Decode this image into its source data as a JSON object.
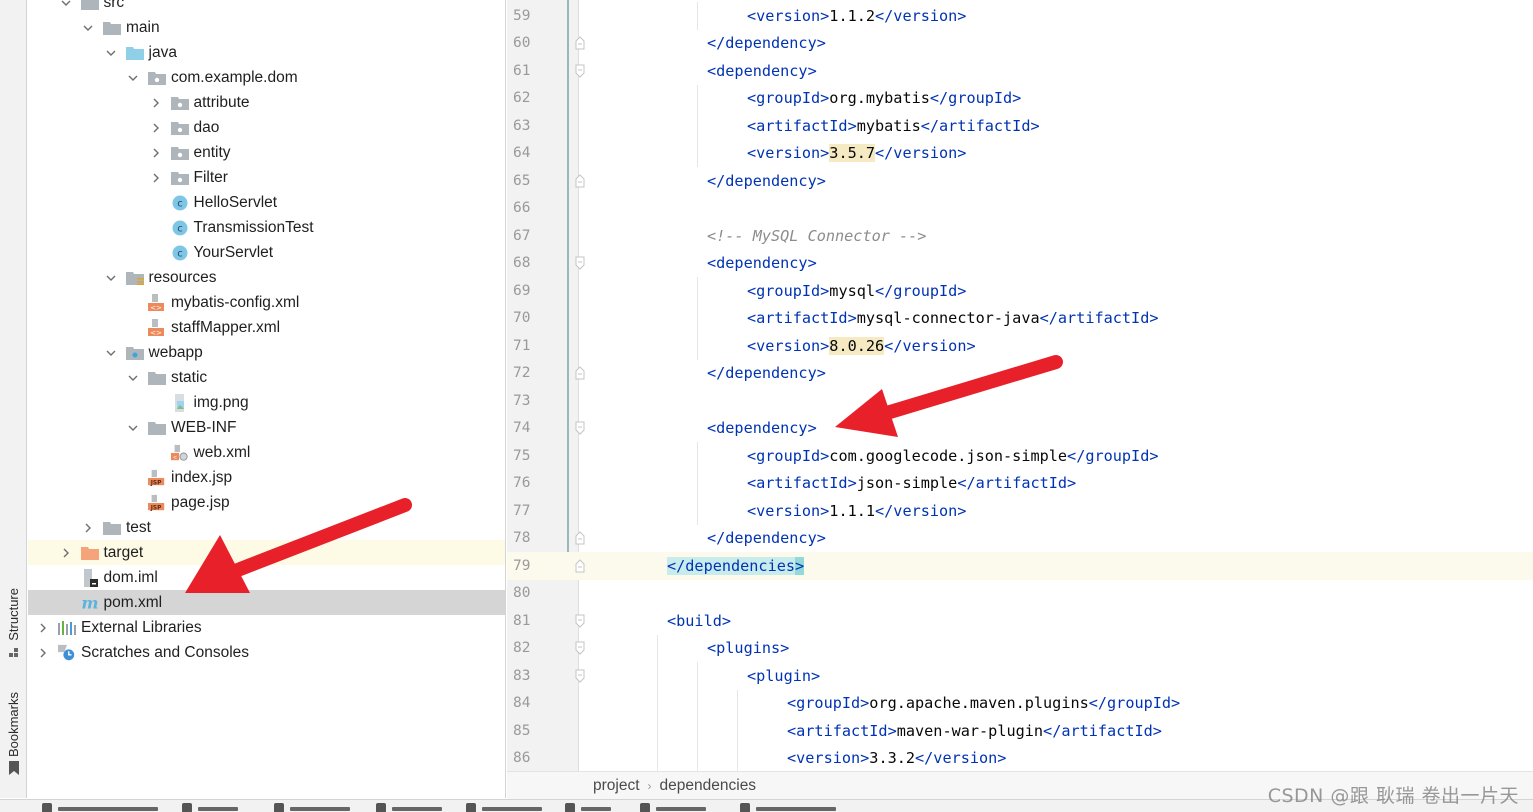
{
  "tool_strip": {
    "structure_label": "Structure",
    "bookmarks_label": "Bookmarks"
  },
  "project_tree": [
    {
      "label": "src",
      "depth": 2,
      "icon": "folder-icon",
      "expanded": true
    },
    {
      "label": "main",
      "depth": 3,
      "icon": "folder-icon",
      "expanded": true
    },
    {
      "label": "java",
      "depth": 4,
      "icon": "source-folder-icon",
      "expanded": true
    },
    {
      "label": "com.example.dom",
      "depth": 5,
      "icon": "package-icon",
      "expanded": true
    },
    {
      "label": "attribute",
      "depth": 6,
      "icon": "package-icon",
      "expanded": false
    },
    {
      "label": "dao",
      "depth": 6,
      "icon": "package-icon",
      "expanded": false
    },
    {
      "label": "entity",
      "depth": 6,
      "icon": "package-icon",
      "expanded": false
    },
    {
      "label": "Filter",
      "depth": 6,
      "icon": "package-icon",
      "expanded": false
    },
    {
      "label": "HelloServlet",
      "depth": 6,
      "icon": "class-icon",
      "leaf": true
    },
    {
      "label": "TransmissionTest",
      "depth": 6,
      "icon": "class-icon",
      "leaf": true
    },
    {
      "label": "YourServlet",
      "depth": 6,
      "icon": "class-icon",
      "leaf": true
    },
    {
      "label": "resources",
      "depth": 4,
      "icon": "resources-folder-icon",
      "expanded": true
    },
    {
      "label": "mybatis-config.xml",
      "depth": 5,
      "icon": "xml-file-icon",
      "leaf": true
    },
    {
      "label": "staffMapper.xml",
      "depth": 5,
      "icon": "xml-file-icon",
      "leaf": true
    },
    {
      "label": "webapp",
      "depth": 4,
      "icon": "web-folder-icon",
      "expanded": true
    },
    {
      "label": "static",
      "depth": 5,
      "icon": "folder-icon",
      "expanded": true
    },
    {
      "label": "img.png",
      "depth": 6,
      "icon": "image-file-icon",
      "leaf": true
    },
    {
      "label": "WEB-INF",
      "depth": 5,
      "icon": "folder-icon",
      "expanded": true
    },
    {
      "label": "web.xml",
      "depth": 6,
      "icon": "web-xml-file-icon",
      "leaf": true
    },
    {
      "label": "index.jsp",
      "depth": 5,
      "icon": "jsp-file-icon",
      "leaf": true
    },
    {
      "label": "page.jsp",
      "depth": 5,
      "icon": "jsp-file-icon",
      "leaf": true
    },
    {
      "label": "test",
      "depth": 3,
      "icon": "folder-icon",
      "expanded": false
    },
    {
      "label": "target",
      "depth": 2,
      "icon": "excluded-folder-icon",
      "expanded": false,
      "highlight": "yellow"
    },
    {
      "label": "dom.iml",
      "depth": 2,
      "icon": "iml-file-icon",
      "leaf": true
    },
    {
      "label": "pom.xml",
      "depth": 2,
      "icon": "maven-icon",
      "leaf": true,
      "selected": true
    },
    {
      "label": "External Libraries",
      "depth": 1,
      "icon": "libraries-icon",
      "expanded": false
    },
    {
      "label": "Scratches and Consoles",
      "depth": 1,
      "icon": "scratches-icon",
      "expanded": false
    }
  ],
  "editor": {
    "caret_line": 79,
    "lines": [
      {
        "n": "59",
        "indent": 3,
        "parts": [
          [
            "tag",
            "<version>"
          ],
          [
            "txt",
            "1.1.2"
          ],
          [
            "tag",
            "</version>"
          ]
        ]
      },
      {
        "n": "60",
        "indent": 2,
        "fold": "end",
        "parts": [
          [
            "tag",
            "</dependency>"
          ]
        ]
      },
      {
        "n": "61",
        "indent": 2,
        "fold": "start",
        "parts": [
          [
            "tag",
            "<dependency>"
          ]
        ]
      },
      {
        "n": "62",
        "indent": 3,
        "parts": [
          [
            "tag",
            "<groupId>"
          ],
          [
            "txt",
            "org.mybatis"
          ],
          [
            "tag",
            "</groupId>"
          ]
        ]
      },
      {
        "n": "63",
        "indent": 3,
        "parts": [
          [
            "tag",
            "<artifactId>"
          ],
          [
            "txt",
            "mybatis"
          ],
          [
            "tag",
            "</artifactId>"
          ]
        ]
      },
      {
        "n": "64",
        "indent": 3,
        "parts": [
          [
            "tag",
            "<version>"
          ],
          [
            "hl",
            "3.5.7"
          ],
          [
            "tag",
            "</version>"
          ]
        ]
      },
      {
        "n": "65",
        "indent": 2,
        "fold": "end",
        "parts": [
          [
            "tag",
            "</dependency>"
          ]
        ]
      },
      {
        "n": "66",
        "indent": 0,
        "parts": []
      },
      {
        "n": "67",
        "indent": 2,
        "parts": [
          [
            "cmt",
            "<!-- MySQL Connector -->"
          ]
        ]
      },
      {
        "n": "68",
        "indent": 2,
        "fold": "start",
        "parts": [
          [
            "tag",
            "<dependency>"
          ]
        ]
      },
      {
        "n": "69",
        "indent": 3,
        "parts": [
          [
            "tag",
            "<groupId>"
          ],
          [
            "txt",
            "mysql"
          ],
          [
            "tag",
            "</groupId>"
          ]
        ]
      },
      {
        "n": "70",
        "indent": 3,
        "parts": [
          [
            "tag",
            "<artifactId>"
          ],
          [
            "txt",
            "mysql-connector-java"
          ],
          [
            "tag",
            "</artifactId>"
          ]
        ]
      },
      {
        "n": "71",
        "indent": 3,
        "parts": [
          [
            "tag",
            "<version>"
          ],
          [
            "hl",
            "8.0.26"
          ],
          [
            "tag",
            "</version>"
          ]
        ]
      },
      {
        "n": "72",
        "indent": 2,
        "fold": "end",
        "parts": [
          [
            "tag",
            "</dependency>"
          ]
        ]
      },
      {
        "n": "73",
        "indent": 0,
        "parts": []
      },
      {
        "n": "74",
        "indent": 2,
        "fold": "start",
        "parts": [
          [
            "tag",
            "<dependency>"
          ]
        ]
      },
      {
        "n": "75",
        "indent": 3,
        "parts": [
          [
            "tag",
            "<groupId>"
          ],
          [
            "txt",
            "com.googlecode.json-simple"
          ],
          [
            "tag",
            "</groupId>"
          ]
        ]
      },
      {
        "n": "76",
        "indent": 3,
        "parts": [
          [
            "tag",
            "<artifactId>"
          ],
          [
            "txt",
            "json-simple"
          ],
          [
            "tag",
            "</artifactId>"
          ]
        ]
      },
      {
        "n": "77",
        "indent": 3,
        "parts": [
          [
            "tag",
            "<version>"
          ],
          [
            "txt",
            "1.1.1"
          ],
          [
            "tag",
            "</version>"
          ]
        ]
      },
      {
        "n": "78",
        "indent": 2,
        "fold": "end",
        "parts": [
          [
            "tag",
            "</dependency>"
          ]
        ]
      },
      {
        "n": "79",
        "indent": 1,
        "fold": "end",
        "parts": [
          [
            "brace",
            "</dependencies"
          ],
          [
            "brace-end",
            ">"
          ]
        ]
      },
      {
        "n": "80",
        "indent": 0,
        "parts": []
      },
      {
        "n": "81",
        "indent": 1,
        "fold": "start",
        "parts": [
          [
            "tag",
            "<build>"
          ]
        ]
      },
      {
        "n": "82",
        "indent": 2,
        "fold": "start",
        "parts": [
          [
            "tag",
            "<plugins>"
          ]
        ]
      },
      {
        "n": "83",
        "indent": 3,
        "fold": "start",
        "parts": [
          [
            "tag",
            "<plugin>"
          ]
        ]
      },
      {
        "n": "84",
        "indent": 4,
        "parts": [
          [
            "tag",
            "<groupId>"
          ],
          [
            "txt",
            "org.apache.maven.plugins"
          ],
          [
            "tag",
            "</groupId>"
          ]
        ]
      },
      {
        "n": "85",
        "indent": 4,
        "parts": [
          [
            "tag",
            "<artifactId>"
          ],
          [
            "txt",
            "maven-war-plugin"
          ],
          [
            "tag",
            "</artifactId>"
          ]
        ]
      },
      {
        "n": "86",
        "indent": 4,
        "parts": [
          [
            "tag",
            "<version>"
          ],
          [
            "txt",
            "3.3.2"
          ],
          [
            "tag",
            "</version>"
          ]
        ]
      }
    ]
  },
  "breadcrumb": {
    "items": [
      "project",
      "dependencies"
    ]
  },
  "watermark": "CSDN @跟 耿瑞 卷出一片天",
  "colors": {
    "tag": "#0033b3",
    "annotation_arrow": "#e8202a",
    "selection": "#d5d5d5",
    "caret_line": "#fcfaed"
  }
}
